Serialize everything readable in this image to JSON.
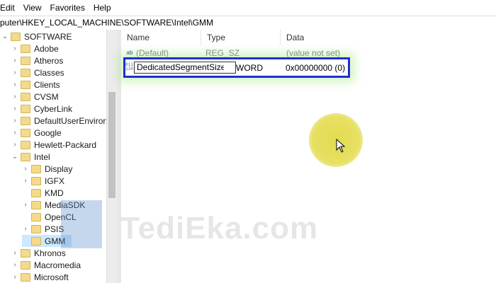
{
  "menu": [
    "Edit",
    "View",
    "Favorites",
    "Help"
  ],
  "address": "puter\\HKEY_LOCAL_MACHINE\\SOFTWARE\\Intel\\GMM",
  "tree": {
    "root": "SOFTWARE",
    "items": [
      "Adobe",
      "Atheros",
      "Classes",
      "Clients",
      "CVSM",
      "CyberLink",
      "DefaultUserEnvironm",
      "Google",
      "Hewlett-Packard",
      "Intel"
    ],
    "intel_children": [
      "Display",
      "IGFX",
      "KMD",
      "MediaSDK",
      "OpenCL",
      "PSIS",
      "GMM"
    ],
    "after": [
      "Khronos",
      "Macromedia",
      "Microsoft"
    ]
  },
  "columns": {
    "name": "Name",
    "type": "Type",
    "data": "Data"
  },
  "values": [
    {
      "name": "(Default)",
      "type": "REG_SZ",
      "data": "(value not set)"
    },
    {
      "name": "DedicatedSegmentSize",
      "type": "WORD",
      "data": "0x00000000 (0)"
    }
  ],
  "watermark": "TediEka.com"
}
